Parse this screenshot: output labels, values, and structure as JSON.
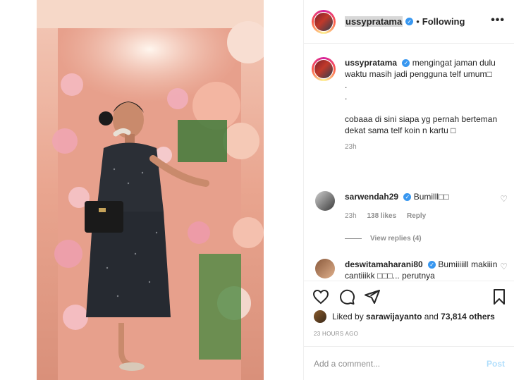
{
  "post": {
    "username": "ussypratama",
    "follow_status": "Following",
    "more_label": "•••",
    "separator": "•"
  },
  "caption": {
    "username": "ussypratama",
    "text": "mengingat jaman dulu waktu masih jadi pengguna telf umum□\n.\n.\n\ncobaaa di sini siapa yg pernah berteman dekat sama telf koin n kartu □",
    "time": "23h"
  },
  "comments": [
    {
      "username": "sarwendah29",
      "text": "Bumilll□□",
      "time": "23h",
      "likes": "138 likes",
      "reply": "Reply",
      "view_replies": "View replies (4)"
    },
    {
      "username": "deswitamaharani80",
      "text": "Bumiiiiill makiiin cantiiikk □□□... perutnya"
    }
  ],
  "likes": {
    "prefix": "Liked by",
    "user": "sarawijayanto",
    "and": "and",
    "others": "73,814 others"
  },
  "timestamp": "23 HOURS AGO",
  "add_comment": {
    "placeholder": "Add a comment...",
    "post_label": "Post"
  },
  "icons": [
    "heart-icon",
    "comment-icon",
    "share-icon",
    "bookmark-icon",
    "verified-icon",
    "more-icon"
  ],
  "colors": {
    "verified": "#3897f0",
    "post_disabled": "#b2dffc",
    "muted": "#8e8e8e"
  }
}
